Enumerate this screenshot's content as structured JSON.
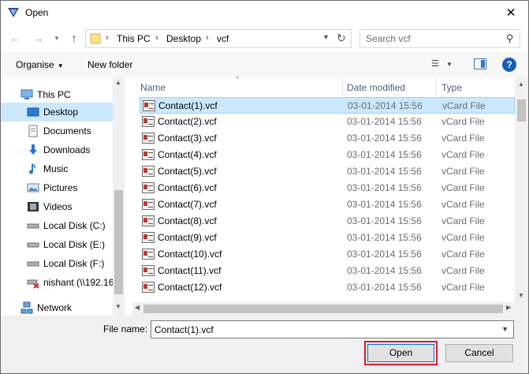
{
  "window": {
    "title": "Open"
  },
  "address": {
    "crumbs": [
      "This PC",
      "Desktop",
      "vcf"
    ]
  },
  "search": {
    "placeholder": "Search vcf"
  },
  "toolbar": {
    "organise": "Organise",
    "new_folder": "New folder",
    "help": "?"
  },
  "navpane": {
    "items": [
      {
        "label": "This PC",
        "icon": "computer-icon"
      },
      {
        "label": "Desktop",
        "icon": "desktop-icon",
        "selected": true
      },
      {
        "label": "Documents",
        "icon": "documents-icon"
      },
      {
        "label": "Downloads",
        "icon": "downloads-icon"
      },
      {
        "label": "Music",
        "icon": "music-icon"
      },
      {
        "label": "Pictures",
        "icon": "pictures-icon"
      },
      {
        "label": "Videos",
        "icon": "videos-icon"
      },
      {
        "label": "Local Disk (C:)",
        "icon": "drive-icon"
      },
      {
        "label": "Local Disk (E:)",
        "icon": "drive-icon"
      },
      {
        "label": "Local Disk (F:)",
        "icon": "drive-icon"
      },
      {
        "label": "nishant (\\\\192.16",
        "icon": "network-drive-disconnected-icon"
      },
      {
        "label": "Network",
        "icon": "network-icon"
      }
    ]
  },
  "columns": {
    "name": "Name",
    "date": "Date modified",
    "type": "Type"
  },
  "files": [
    {
      "name": "Contact(1).vcf",
      "date": "03-01-2014 15:56",
      "type": "vCard File",
      "selected": true
    },
    {
      "name": "Contact(2).vcf",
      "date": "03-01-2014 15:56",
      "type": "vCard File"
    },
    {
      "name": "Contact(3).vcf",
      "date": "03-01-2014 15:56",
      "type": "vCard File"
    },
    {
      "name": "Contact(4).vcf",
      "date": "03-01-2014 15:56",
      "type": "vCard File"
    },
    {
      "name": "Contact(5).vcf",
      "date": "03-01-2014 15:56",
      "type": "vCard File"
    },
    {
      "name": "Contact(6).vcf",
      "date": "03-01-2014 15:56",
      "type": "vCard File"
    },
    {
      "name": "Contact(7).vcf",
      "date": "03-01-2014 15:56",
      "type": "vCard File"
    },
    {
      "name": "Contact(8).vcf",
      "date": "03-01-2014 15:56",
      "type": "vCard File"
    },
    {
      "name": "Contact(9).vcf",
      "date": "03-01-2014 15:56",
      "type": "vCard File"
    },
    {
      "name": "Contact(10).vcf",
      "date": "03-01-2014 15:56",
      "type": "vCard File"
    },
    {
      "name": "Contact(11).vcf",
      "date": "03-01-2014 15:56",
      "type": "vCard File"
    },
    {
      "name": "Contact(12).vcf",
      "date": "03-01-2014 15:56",
      "type": "vCard File"
    }
  ],
  "footer": {
    "file_name_label": "File name:",
    "file_name_value": "Contact(1).vcf",
    "open": "Open",
    "cancel": "Cancel"
  },
  "colors": {
    "selection": "#cce8ff",
    "highlight": "#e8152a",
    "accent": "#0078d7"
  }
}
